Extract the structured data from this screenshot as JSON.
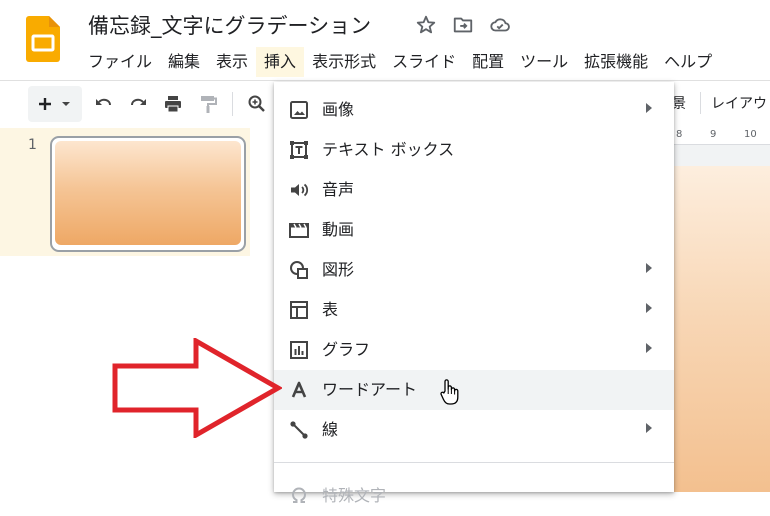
{
  "app": {
    "title": "備忘録_文字にグラデーション",
    "brand_color": "#f9ab00"
  },
  "menubar": {
    "items": [
      {
        "label": "ファイル",
        "active": false
      },
      {
        "label": "編集",
        "active": false
      },
      {
        "label": "表示",
        "active": false
      },
      {
        "label": "挿入",
        "active": true
      },
      {
        "label": "表示形式",
        "active": false
      },
      {
        "label": "スライド",
        "active": false
      },
      {
        "label": "配置",
        "active": false
      },
      {
        "label": "ツール",
        "active": false
      },
      {
        "label": "拡張機能",
        "active": false
      },
      {
        "label": "ヘルプ",
        "active": false
      }
    ]
  },
  "toolbar": {
    "icons": [
      "add-icon",
      "dropdown-caret-icon",
      "undo-icon",
      "redo-icon",
      "print-icon",
      "paint-format-icon",
      "zoom-icon"
    ],
    "right_partial_text": "景",
    "layout_label": "レイアウ"
  },
  "filmstrip": {
    "slide_number": "1"
  },
  "ruler": {
    "ticks": [
      "8",
      "9",
      "10"
    ]
  },
  "insert_menu": {
    "items": [
      {
        "label": "画像",
        "icon": "image-icon",
        "has_submenu": true
      },
      {
        "label": "テキスト ボックス",
        "icon": "text-box-icon",
        "has_submenu": false
      },
      {
        "label": "音声",
        "icon": "audio-icon",
        "has_submenu": false
      },
      {
        "label": "動画",
        "icon": "video-icon",
        "has_submenu": false
      },
      {
        "label": "図形",
        "icon": "shape-icon",
        "has_submenu": true
      },
      {
        "label": "表",
        "icon": "table-icon",
        "has_submenu": true
      },
      {
        "label": "グラフ",
        "icon": "chart-icon",
        "has_submenu": true
      },
      {
        "label": "ワードアート",
        "icon": "word-art-icon",
        "has_submenu": false,
        "hovered": true
      },
      {
        "label": "線",
        "icon": "line-icon",
        "has_submenu": true
      },
      {
        "label": "特殊文字",
        "icon": "omega-icon",
        "has_submenu": false
      }
    ]
  },
  "annotation": {
    "arrow_color": "#e0242b"
  }
}
